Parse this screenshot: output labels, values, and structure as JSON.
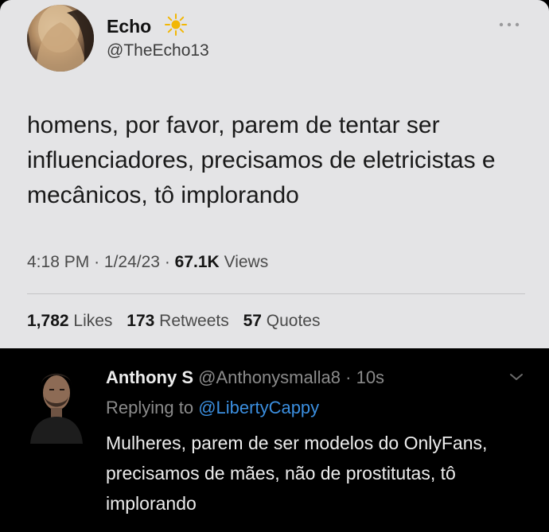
{
  "original_tweet": {
    "display_name": "Echo",
    "name_emoji": "sun-icon",
    "handle": "@TheEcho13",
    "text": "homens, por favor, parem de tentar ser influenciadores, precisamos de eletricistas e mecânicos, tô implorando",
    "time": "4:18 PM",
    "date": "1/24/23",
    "separator": "·",
    "views_count": "67.1K",
    "views_label": "Views",
    "likes_count": "1,782",
    "likes_label": "Likes",
    "retweets_count": "173",
    "retweets_label": "Retweets",
    "quotes_count": "57",
    "quotes_label": "Quotes"
  },
  "reply_tweet": {
    "display_name": "Anthony S",
    "handle": "@Anthonysmalla8",
    "separator": "·",
    "timestamp": "10s",
    "replying_to_label": "Replying to",
    "replying_to_handle": "@LibertyCappy",
    "text": "Mulheres, parem de ser modelos do OnlyFans, precisamos de mães, não de prostitutas, tô implorando"
  },
  "colors": {
    "light_card_bg": "#e4e4e6",
    "dark_bg": "#000000",
    "mention_blue": "#3b8fe0",
    "sun_yellow": "#f2b705"
  }
}
